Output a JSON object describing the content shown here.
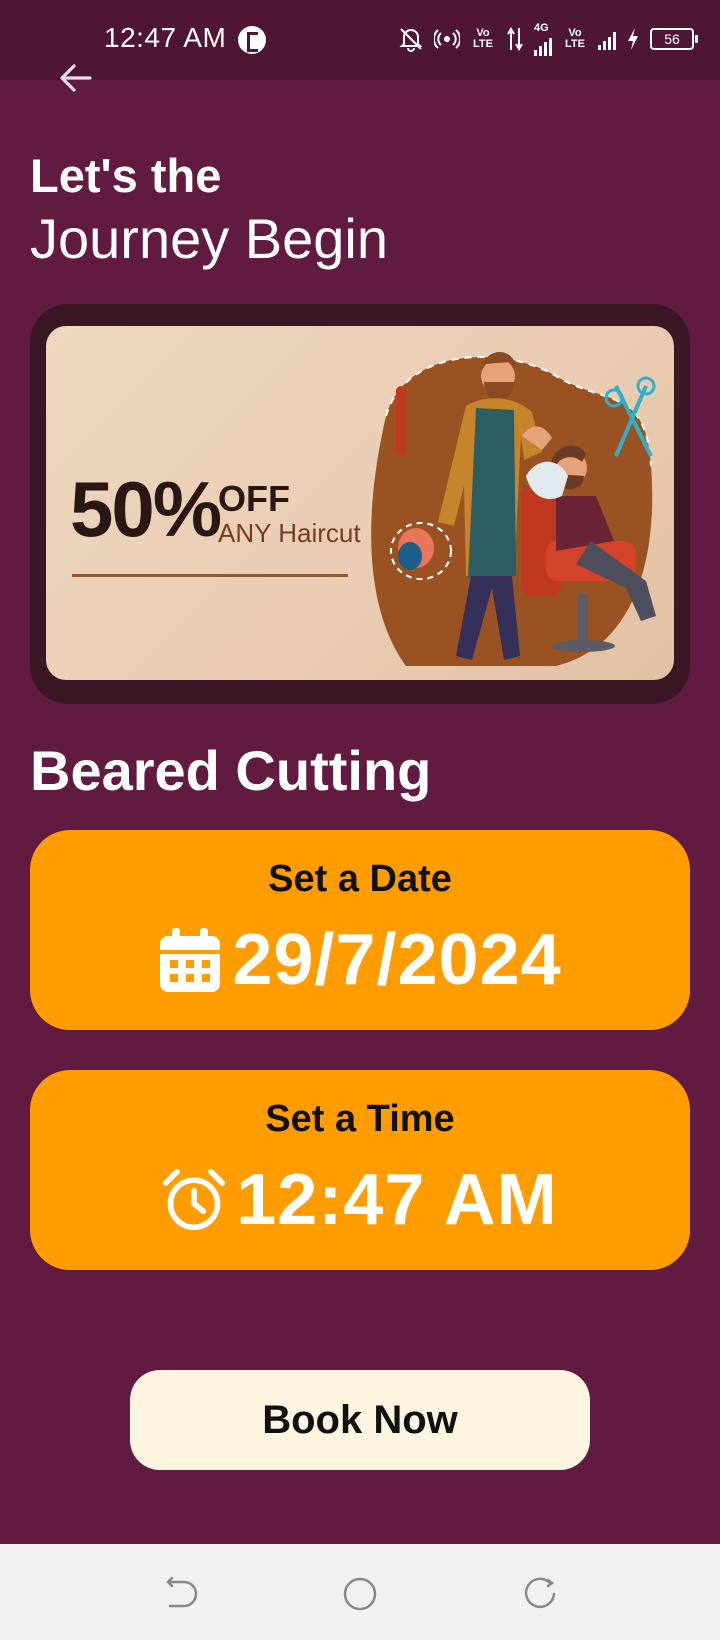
{
  "status_bar": {
    "time": "12:47 AM",
    "net_4g": "4G",
    "volte_1": "Vo\nLTE",
    "volte_2": "Vo\nLTE",
    "battery": "56"
  },
  "header": {
    "line1": "Let's the",
    "line2": "Journey Begin"
  },
  "banner": {
    "discount": "50%",
    "off": "OFF",
    "subtitle": "ANY Haircut"
  },
  "service": {
    "title": "Beared Cutting"
  },
  "date_picker": {
    "label": "Set a Date",
    "value": "29/7/2024",
    "icon": "calendar-icon"
  },
  "time_picker": {
    "label": "Set a Time",
    "value": "12:47 AM",
    "icon": "alarm-clock-icon"
  },
  "actions": {
    "book_label": "Book Now"
  },
  "colors": {
    "background": "#621b40",
    "status_bar": "#4f1634",
    "accent": "#fe9c00",
    "button": "#fdf5e0"
  }
}
